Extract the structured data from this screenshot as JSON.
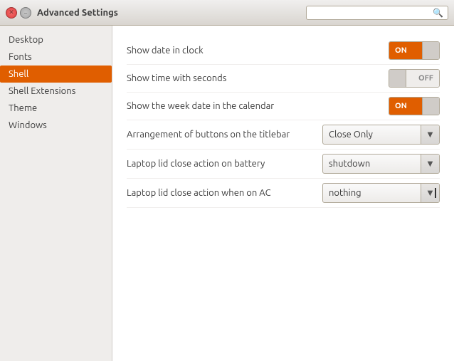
{
  "titlebar": {
    "title": "Advanced Settings",
    "search_placeholder": ""
  },
  "sidebar": {
    "items": [
      {
        "id": "desktop",
        "label": "Desktop",
        "active": false
      },
      {
        "id": "fonts",
        "label": "Fonts",
        "active": false
      },
      {
        "id": "shell",
        "label": "Shell",
        "active": true
      },
      {
        "id": "shell-extensions",
        "label": "Shell Extensions",
        "active": false
      },
      {
        "id": "theme",
        "label": "Theme",
        "active": false
      },
      {
        "id": "windows",
        "label": "Windows",
        "active": false
      }
    ]
  },
  "settings": {
    "rows": [
      {
        "id": "show-date",
        "label": "Show date in clock",
        "control": "toggle-on",
        "on_label": "ON",
        "off_label": "OFF"
      },
      {
        "id": "show-seconds",
        "label": "Show time with seconds",
        "control": "toggle-off",
        "on_label": "ON",
        "off_label": "OFF"
      },
      {
        "id": "show-week",
        "label": "Show the week date in the calendar",
        "control": "toggle-on",
        "on_label": "ON",
        "off_label": "OFF"
      },
      {
        "id": "titlebar-buttons",
        "label": "Arrangement of buttons on the titlebar",
        "control": "dropdown",
        "value": "Close Only"
      },
      {
        "id": "lid-battery",
        "label": "Laptop lid close action on battery",
        "control": "dropdown",
        "value": "shutdown"
      },
      {
        "id": "lid-ac",
        "label": "Laptop lid close action when on AC",
        "control": "dropdown",
        "value": "nothing"
      }
    ]
  },
  "icons": {
    "close": "✕",
    "minimize": "−",
    "search": "🔍",
    "dropdown_arrow": "▼"
  }
}
